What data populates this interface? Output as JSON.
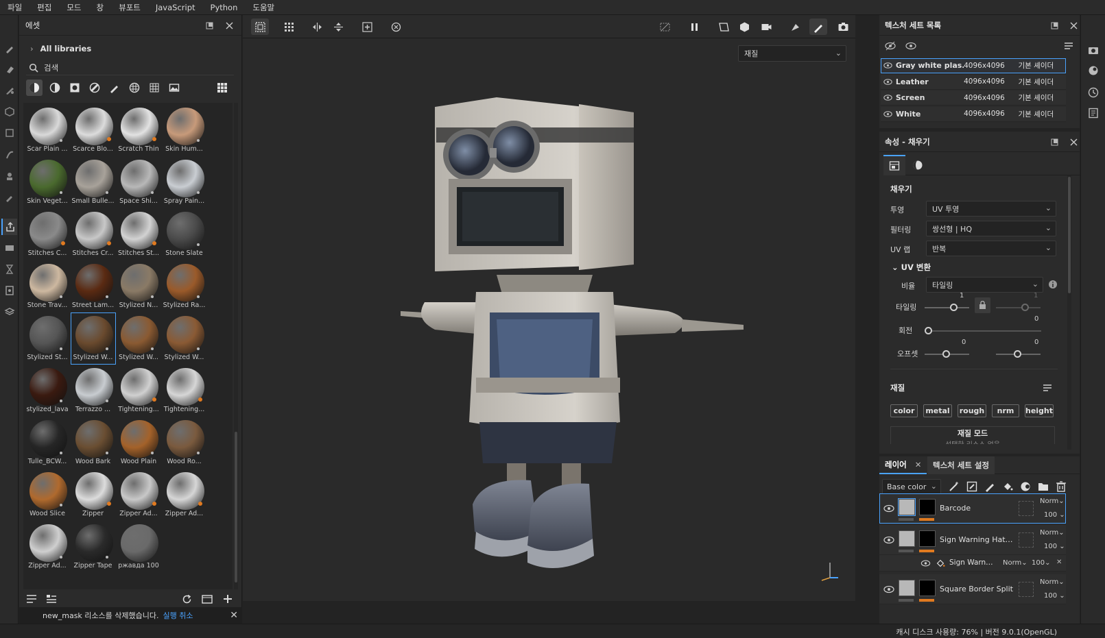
{
  "menu": [
    "파일",
    "편집",
    "모드",
    "창",
    "뷰포트",
    "JavaScript",
    "Python",
    "도움말"
  ],
  "assets": {
    "title": "에셋",
    "libraries_label": "All libraries",
    "search_value": "검색",
    "notification": "new_mask 리소스를 삭제했습니다.",
    "undo_label": "실행 취소",
    "items": [
      {
        "name": "Scar Plain ...",
        "color": "#d9d9d9",
        "icon": "dot"
      },
      {
        "name": "Scarce Blo...",
        "color": "#dcdcdc",
        "icon": "orange"
      },
      {
        "name": "Scratch Thin",
        "color": "#e2e2e2",
        "icon": "orange"
      },
      {
        "name": "Skin Hum...",
        "color": "#c79a7a",
        "icon": "dot"
      },
      {
        "name": "Skin Veget...",
        "color": "#4a6a2e",
        "icon": "dot"
      },
      {
        "name": "Small Bulle...",
        "color": "#a8a29a",
        "icon": "dot"
      },
      {
        "name": "Space Shi...",
        "color": "#b8b8b8",
        "icon": "dot"
      },
      {
        "name": "Spray Pain...",
        "color": "#c9cdd2",
        "icon": "dot"
      },
      {
        "name": "Stitches C...",
        "color": "#8a8a8a",
        "icon": "orange"
      },
      {
        "name": "Stitches Cr...",
        "color": "#c8c8c8",
        "icon": "orange"
      },
      {
        "name": "Stitches St...",
        "color": "#d2d2d2",
        "icon": "orange"
      },
      {
        "name": "Stone Slate",
        "color": "#4b4b4b",
        "icon": "dot"
      },
      {
        "name": "Stone Trav...",
        "color": "#cdb8a0",
        "icon": "dot"
      },
      {
        "name": "Street Lam...",
        "color": "#5a2a12",
        "icon": "dot"
      },
      {
        "name": "Stylized N...",
        "color": "#8a7a66",
        "icon": "dot"
      },
      {
        "name": "Stylized Ra...",
        "color": "#9a5a2a",
        "icon": "dot"
      },
      {
        "name": "Stylized St...",
        "color": "#555555",
        "icon": "dot"
      },
      {
        "name": "Stylized W...",
        "color": "#6a4a2e",
        "icon": "dot"
      },
      {
        "name": "Stylized W...",
        "color": "#8a5a32",
        "icon": "dot"
      },
      {
        "name": "Stylized W...",
        "color": "#8a5a34",
        "icon": "dot"
      },
      {
        "name": "stylized_lava",
        "color": "#3a1a10",
        "icon": "dot"
      },
      {
        "name": "Terrazzo ...",
        "color": "#c8ccd0",
        "icon": "dot"
      },
      {
        "name": "Tightening...",
        "color": "#d0d0d0",
        "icon": "orange"
      },
      {
        "name": "Tightening...",
        "color": "#d6d6d6",
        "icon": "orange"
      },
      {
        "name": "Tulle_BCW...",
        "color": "#262626",
        "icon": "dot"
      },
      {
        "name": "Wood Bark",
        "color": "#6a4e32",
        "icon": "dot"
      },
      {
        "name": "Wood Plain",
        "color": "#a4622a",
        "icon": "dot"
      },
      {
        "name": "Wood Ro...",
        "color": "#7a5a3e",
        "icon": "dot"
      },
      {
        "name": "Wood Slice",
        "color": "#b06a2e",
        "icon": "dot"
      },
      {
        "name": "Zipper",
        "color": "#dcdcdc",
        "icon": "orange"
      },
      {
        "name": "Zipper Ad...",
        "color": "#c8c8c8",
        "icon": "orange"
      },
      {
        "name": "Zipper Ad...",
        "color": "#d6d6d6",
        "icon": "orange"
      },
      {
        "name": "Zipper Ad...",
        "color": "#cfcfcf",
        "icon": "dot"
      },
      {
        "name": "Zipper Tape",
        "color": "#2a2a2a",
        "icon": "dot"
      },
      {
        "name": "ржавда 100",
        "color": "#6a6a6a",
        "icon": "none"
      }
    ],
    "selected_index": 17
  },
  "viewport": {
    "material_select": "재질"
  },
  "texture_sets": {
    "title": "텍스처 세트 목록",
    "rows": [
      {
        "name": "Gray white plas...",
        "res": "4096x4096",
        "shader": "기본 셰이더"
      },
      {
        "name": "Leather",
        "res": "4096x4096",
        "shader": "기본 셰이더"
      },
      {
        "name": "Screen",
        "res": "4096x4096",
        "shader": "기본 셰이더"
      },
      {
        "name": "White",
        "res": "4096x4096",
        "shader": "기본 셰이더"
      }
    ]
  },
  "properties": {
    "title": "속성 - 채우기",
    "section_fill": "채우기",
    "projection_label": "투영",
    "projection_value": "UV 투영",
    "filter_label": "필터링",
    "filter_value": "쌍선형 | HQ",
    "uvwrap_label": "UV 랩",
    "uvwrap_value": "반복",
    "uvtransform_label": "UV 변환",
    "ratio_label": "비율",
    "ratio_value": "타일링",
    "tiling_label": "타일링",
    "tiling_value": "1",
    "tiling_value2": "1",
    "rotation_label": "회전",
    "rotation_value": "0",
    "offset_label": "오프셋",
    "offset_u": "0",
    "offset_v": "0",
    "material_section": "재질",
    "channels": [
      "color",
      "metal",
      "rough",
      "nrm",
      "height"
    ],
    "material_mode": "재질 모드",
    "material_mode_sub": "선택한 리소스 없음"
  },
  "layers": {
    "tab_layers": "레이어",
    "tab_txset": "텍스처 세트 설정",
    "channel": "Base color",
    "rows": [
      {
        "name": "Barcode",
        "blend": "Norm",
        "opacity": "100"
      },
      {
        "name": "Sign Warning Hat…",
        "blend": "Norm",
        "opacity": "100"
      },
      {
        "name": "Square Border Split",
        "blend": "Norm",
        "opacity": "100"
      }
    ],
    "effect": {
      "name": "Sign Warn…",
      "blend": "Norm",
      "opacity": "100"
    }
  },
  "status": "캐시 디스크 사용량:  76% | 버전 9.0.1(OpenGL)",
  "accent": "#4aa3ff"
}
